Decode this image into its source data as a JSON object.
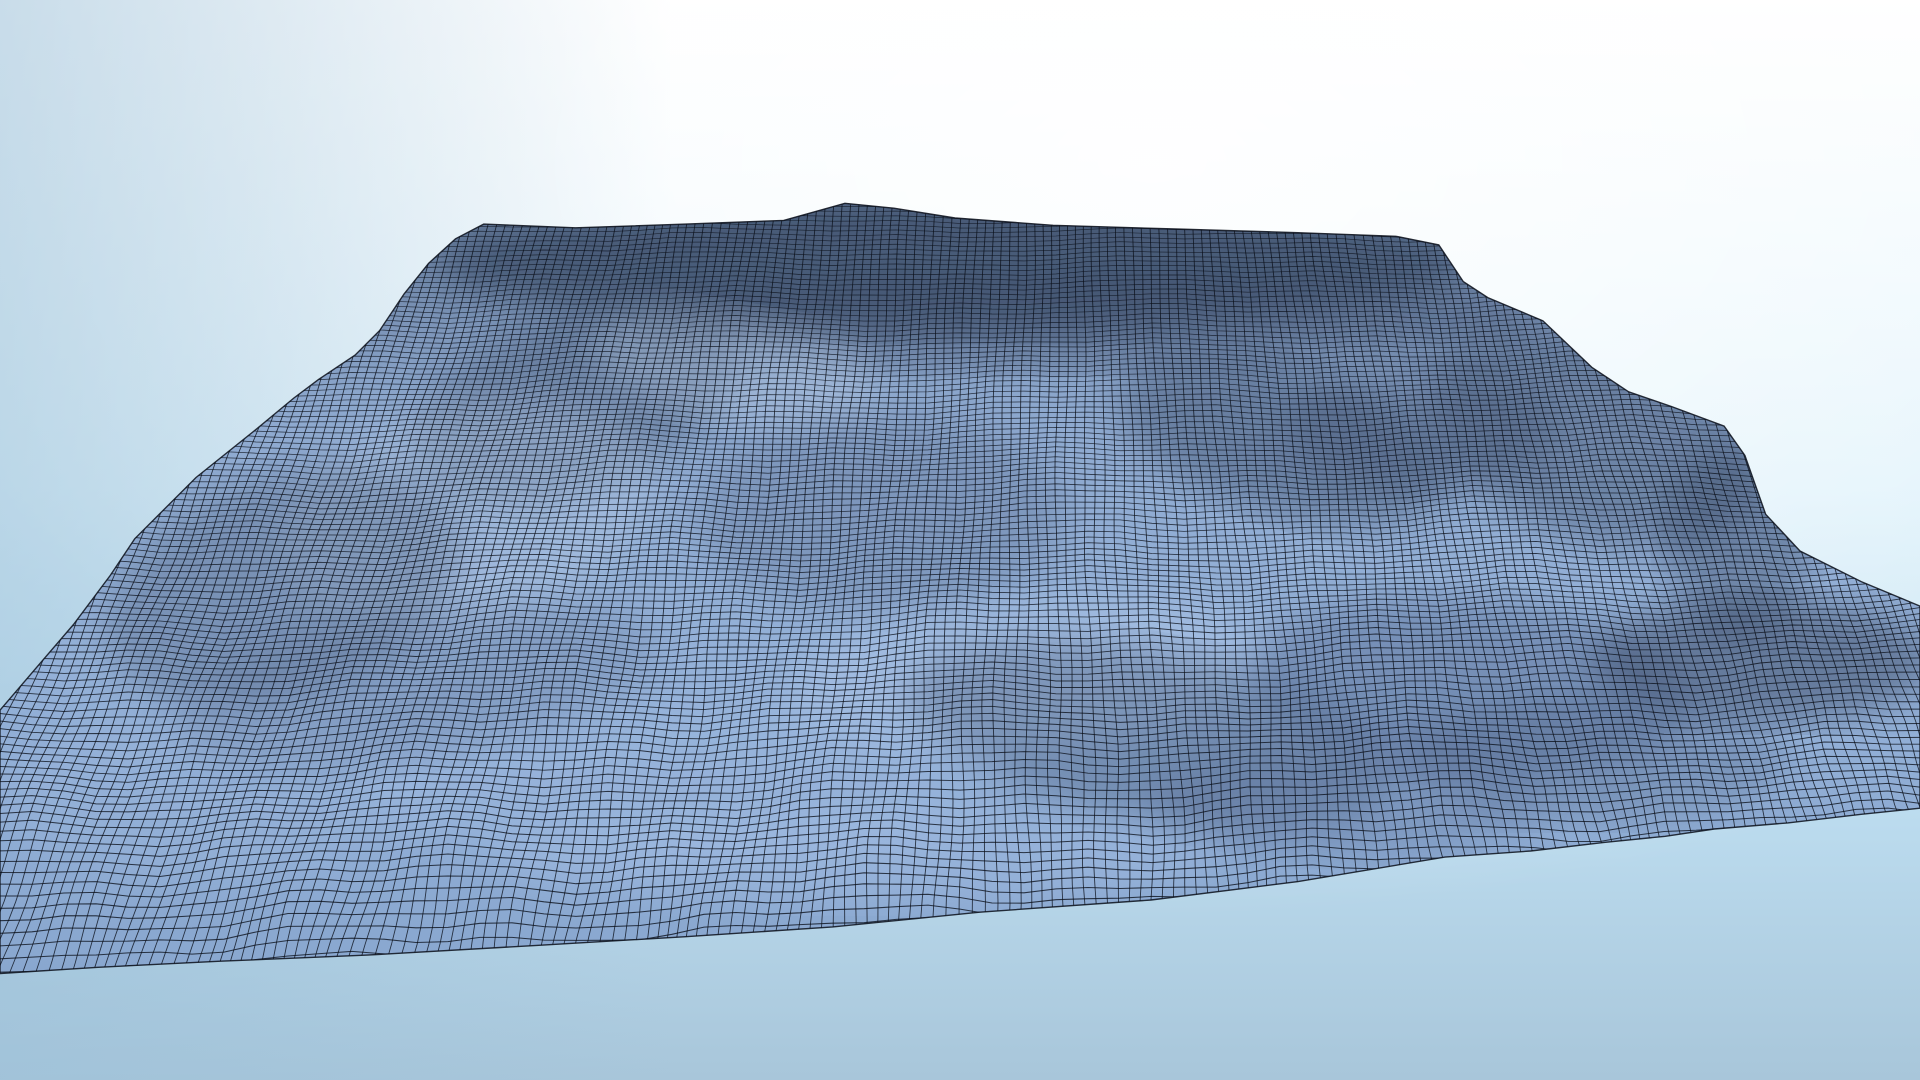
{
  "scene": {
    "subject": "terrain-mesh-wireframe",
    "colors": {
      "sky_top": "#ffffff",
      "sky_mid": "#d6eef9",
      "sky_bottom": "#a9c8dc",
      "sky_right_tint": "#c9e9ff",
      "mesh_fill": "#90aed6",
      "mesh_shadow": "#5f7aa0",
      "mesh_highlight": "#a8c2e6",
      "grid_line": "#0a0f1a"
    }
  }
}
